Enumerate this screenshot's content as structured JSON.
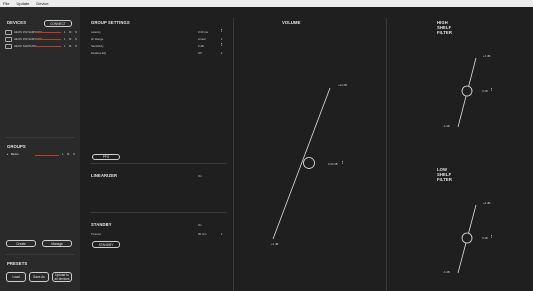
{
  "menu": [
    "File",
    "Update",
    "Device"
  ],
  "devices": {
    "title": "DEVICES",
    "connect_label": "CONNECT",
    "items": [
      {
        "name": "HEOS 150 SAMSUNG",
        "a": "1",
        "b": "M",
        "c": "S"
      },
      {
        "name": "HEOS 150 SAMSUNG",
        "a": "1",
        "b": "M",
        "c": "S"
      },
      {
        "name": "HEOS SAMSUNG",
        "a": "1",
        "b": "M",
        "c": "S"
      }
    ]
  },
  "groups": {
    "title": "GROUPS",
    "items": [
      {
        "name": "Demo",
        "a": "1",
        "b": "M",
        "c": "S"
      }
    ],
    "create_label": "Create",
    "manage_label": "Manage"
  },
  "presets": {
    "title": "PRESETS",
    "load_label": "Load",
    "save_as_label": "Save As",
    "upload_label_1": "Upload to",
    "upload_label_2": "all devices"
  },
  "group_settings": {
    "title": "GROUP SETTINGS",
    "rows": [
      {
        "label": "Latency",
        "value": "0.00 ms"
      },
      {
        "label": "LF Range",
        "value": "Linear"
      },
      {
        "label": "Sensitivity",
        "value": "0 dB"
      },
      {
        "label": "Desktop EQ",
        "value": "Off"
      }
    ],
    "pfo_label": "PFO"
  },
  "linearizer": {
    "title": "LINEARIZER",
    "value": "On"
  },
  "standby": {
    "title": "STANDBY",
    "value": "On",
    "timeout_label": "Timeout",
    "timeout_value": "90 min",
    "button_label": "STANDBY"
  },
  "volume": {
    "title": "VOLUME",
    "top_label": "+12 dB",
    "bottom_label": "+2 dB",
    "value_label": "0.00 dB",
    "level": 0.5
  },
  "high_shelf": {
    "title_1": "HIGH",
    "title_2": "SHELF",
    "title_3": "FILTER",
    "top_label": "+4 dB",
    "bottom_label": "-4 dB",
    "value_label": "0 dB",
    "level": 0.5
  },
  "low_shelf": {
    "title_1": "LOW",
    "title_2": "SHELF",
    "title_3": "FILTER",
    "top_label": "+4 dB",
    "bottom_label": "-4 dB",
    "value_label": "0 dB",
    "level": 0.5
  },
  "colors": {
    "accent_red": "#c0392b",
    "background": "#1f1f1f",
    "sidebar": "#2a2a2a"
  }
}
